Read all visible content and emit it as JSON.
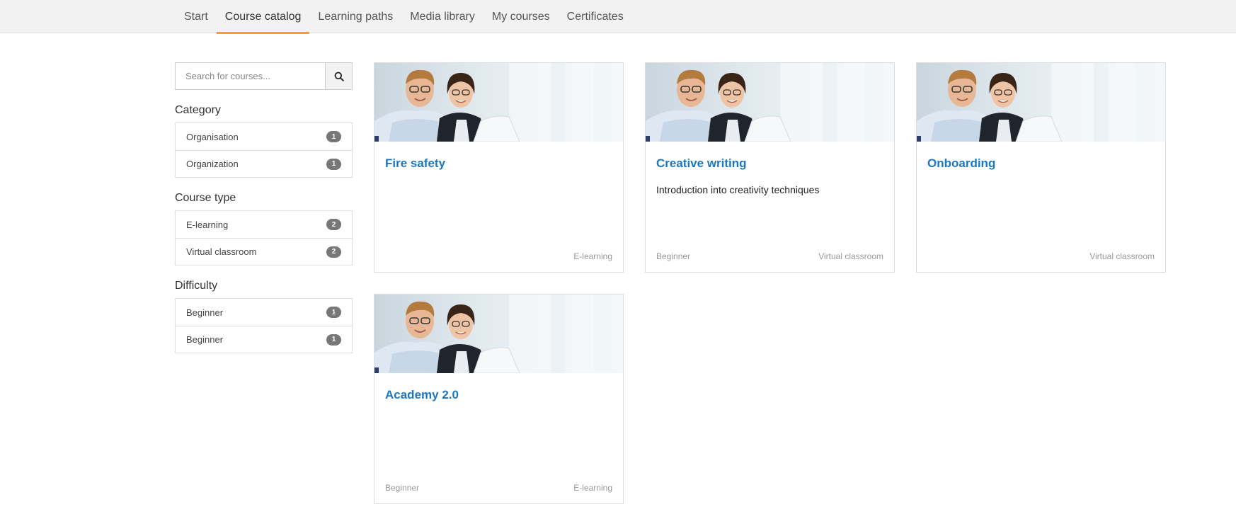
{
  "nav": {
    "tabs": [
      {
        "label": "Start"
      },
      {
        "label": "Course catalog",
        "active": true
      },
      {
        "label": "Learning paths"
      },
      {
        "label": "Media library"
      },
      {
        "label": "My courses"
      },
      {
        "label": "Certificates"
      }
    ],
    "accent_color": "#f0a030"
  },
  "search": {
    "placeholder": "Search for courses...",
    "icon": "search-icon"
  },
  "facets": {
    "category": {
      "title": "Category",
      "items": [
        {
          "label": "Organisation",
          "count": "1"
        },
        {
          "label": "Organization",
          "count": "1"
        }
      ]
    },
    "course_type": {
      "title": "Course type",
      "items": [
        {
          "label": "E-learning",
          "count": "2"
        },
        {
          "label": "Virtual classroom",
          "count": "2"
        }
      ]
    },
    "difficulty": {
      "title": "Difficulty",
      "items": [
        {
          "label": "Beginner",
          "count": "1"
        },
        {
          "label": "Beginner",
          "count": "1"
        }
      ]
    }
  },
  "courses": [
    {
      "title": "Fire safety",
      "description": "",
      "difficulty": "",
      "type": "E-learning"
    },
    {
      "title": "Creative writing",
      "description": "Introduction into creativity techniques",
      "difficulty": "Beginner",
      "type": "Virtual classroom"
    },
    {
      "title": "Onboarding",
      "description": "",
      "difficulty": "",
      "type": "Virtual classroom"
    },
    {
      "title": "Academy 2.0",
      "description": "",
      "difficulty": "Beginner",
      "type": "E-learning"
    }
  ],
  "colors": {
    "link": "#1a78c2",
    "badge": "#777777"
  }
}
